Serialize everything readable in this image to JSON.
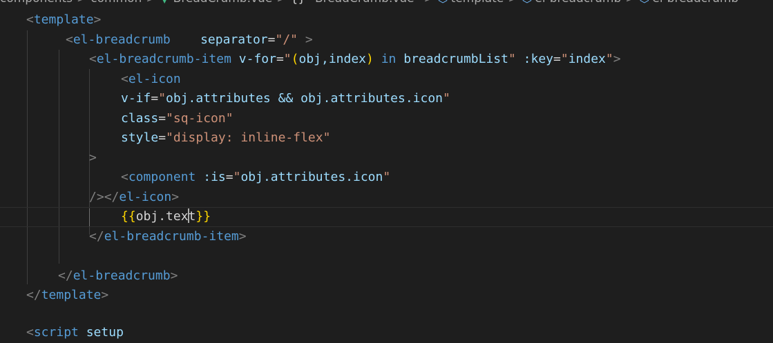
{
  "breadcrumbs": {
    "items": [
      "components",
      "common",
      "BreadCrumb.vue",
      "\"BreadCrumb.vue\"",
      "template",
      "el-breadcrumb",
      "el-breadcrumb"
    ],
    "separator": ">",
    "icons": {
      "file": "vue-file-icon",
      "script": "braces-icon",
      "node": "cube-icon"
    }
  },
  "code": {
    "l1_lt": "<",
    "l1_tag": "template",
    "l1_gt": ">",
    "l2_lt": "<",
    "l2_tag": "el-breadcrumb",
    "l2_attr": "separator",
    "l2_eq": "=",
    "l2_val": "\"/\"",
    "l2_gt": ">",
    "l3_lt": "<",
    "l3_tag": "el-breadcrumb-item",
    "l3_attr": "v-for",
    "l3_eq": "=",
    "l3_q1": "\"",
    "l3_p1": "(",
    "l3_expr1": "obj,index",
    "l3_p2": ")",
    "l3_in": "in",
    "l3_expr2": "breadcrumbList",
    "l3_q2": "\"",
    "l3_attr2": ":key",
    "l3_eq2": "=",
    "l3_q3": "\"",
    "l3_expr3": "index",
    "l3_q4": "\"",
    "l3_gt": ">",
    "l4_lt": "<",
    "l4_tag": "el-icon",
    "l5_attr": "v-if",
    "l5_eq": "=",
    "l5_q1": "\"",
    "l5_expr": "obj.attributes && obj.attributes.icon",
    "l5_q2": "\"",
    "l6_attr": "class",
    "l6_eq": "=",
    "l6_val": "\"sq-icon\"",
    "l7_attr": "style",
    "l7_eq": "=",
    "l7_val": "\"display: inline-flex\"",
    "l8_gt": ">",
    "l9_lt": "<",
    "l9_tag": "component",
    "l9_attr": ":is",
    "l9_eq": "=",
    "l9_q1": "\"",
    "l9_expr": "obj.attributes.icon",
    "l9_q2": "\"",
    "l10_close": "/>",
    "l10_lt": "</",
    "l10_tag": "el-icon",
    "l10_gt": ">",
    "l11_open": "{{",
    "l11_text_a": "obj.tex",
    "l11_text_b": "t",
    "l11_close": "}}",
    "l12_lt": "</",
    "l12_tag": "el-breadcrumb-item",
    "l12_gt": ">",
    "l14_lt": "</",
    "l14_tag": "el-breadcrumb",
    "l14_gt": ">",
    "l15_lt": "</",
    "l15_tag": "template",
    "l15_gt": ">",
    "l17_lt": "<",
    "l17_tag": "script",
    "l17_attr": "setup"
  }
}
